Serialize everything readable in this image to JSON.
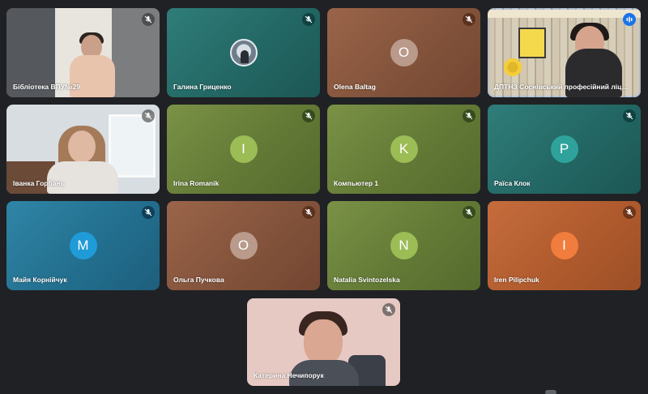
{
  "participants": [
    {
      "name": "Бібліотека ВПУ№29",
      "mic": "muted",
      "video": "on"
    },
    {
      "name": "Галина Гриценко",
      "mic": "muted",
      "avatar": "photo"
    },
    {
      "name": "Olena Baltag",
      "mic": "muted",
      "initial": "O"
    },
    {
      "name": "ДПТНЗ Соснівський професійний ліц...",
      "mic": "speaking",
      "video": "on"
    },
    {
      "name": "Іванка Горбань",
      "mic": "muted",
      "video": "on"
    },
    {
      "name": "Irina Romanik",
      "mic": "muted",
      "initial": "I"
    },
    {
      "name": "Компьютер 1",
      "mic": "muted",
      "initial": "K"
    },
    {
      "name": "Раїса Клок",
      "mic": "muted",
      "initial": "P"
    },
    {
      "name": "Майя Корнійчук",
      "mic": "muted",
      "initial": "M"
    },
    {
      "name": "Ольга Пучкова",
      "mic": "muted",
      "initial": "О"
    },
    {
      "name": "Natalia Svintozelska",
      "mic": "muted",
      "initial": "N"
    },
    {
      "name": "Iren Pilipchuk",
      "mic": "muted",
      "initial": "I"
    },
    {
      "name": "Катерина Нечипорук",
      "mic": "muted",
      "video": "on"
    }
  ],
  "colors": {
    "background": "#202124",
    "green": "#637a36",
    "teal": "#236764",
    "brown": "#83533b",
    "blue": "#236f8f",
    "orange": "#b05b2e",
    "speaking": "#1a73e8"
  },
  "icons": {
    "muted": "mic-off-icon",
    "speaking": "audio-level-icon"
  }
}
